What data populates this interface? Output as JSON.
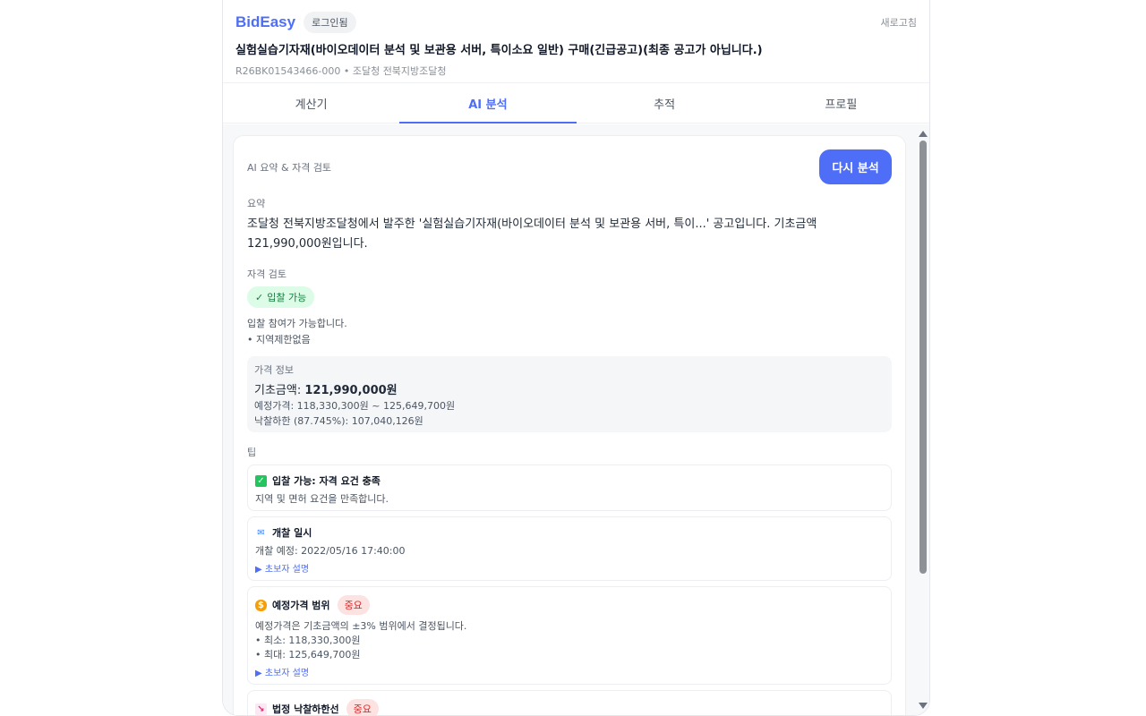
{
  "header": {
    "brand": "BidEasy",
    "login_badge": "로그인됨",
    "refresh": "새로고침",
    "title": "실험실습기자재(바이오데이터 분석 및 보관용 서버, 특이소요 일반) 구매(긴급공고)(최종 공고가 아닙니다.)",
    "meta": "R26BK01543466-000 • 조달청 전북지방조달청"
  },
  "tabs": [
    {
      "label": "계산기",
      "active": false
    },
    {
      "label": "AI 분석",
      "active": true
    },
    {
      "label": "추적",
      "active": false
    },
    {
      "label": "프로필",
      "active": false
    }
  ],
  "analysis": {
    "section_label": "AI 요약 & 자격 검토",
    "reanalyze_button": "다시 분석",
    "summary_label": "요약",
    "summary_text": "조달청 전북지방조달청에서 발주한 '실험실습기자재(바이오데이터 분석 및 보관용 서버, 특이...' 공고입니다. 기초금액 121,990,000원입니다.",
    "qualification_label": "자격 검토",
    "qualification_badge": "입찰 가능",
    "qualification_desc": "입찰 참여가 가능합니다.",
    "qualification_note": "• 지역제한없음"
  },
  "price": {
    "title": "가격 정보",
    "base_label": "기초금액:",
    "base_value": "121,990,000원",
    "estimate": "예정가격: 118,330,300원 ~ 125,649,700원",
    "lower_limit": "낙찰하한 (87.745%): 107,040,126원"
  },
  "tips": {
    "label": "팁",
    "items": [
      {
        "icon": "check-box-icon",
        "title": "입찰 가능: 자격 요건 충족",
        "important": "",
        "lines": [
          "지역 및 면허 요건을 만족합니다."
        ],
        "link": ""
      },
      {
        "icon": "mailbox-icon",
        "title": "개찰 일시",
        "important": "",
        "lines": [
          "개찰 예정: 2022/05/16 17:40:00"
        ],
        "link": "▶ 초보자 설명"
      },
      {
        "icon": "money-bag-icon",
        "title": "예정가격 범위",
        "important": "중요",
        "lines": [
          "예정가격은 기초금액의 ±3% 범위에서 결정됩니다.",
          "• 최소: 118,330,300원",
          "• 최대: 125,649,700원"
        ],
        "link": "▶ 초보자 설명"
      },
      {
        "icon": "chart-down-icon",
        "title": "법정 낙찰하한선",
        "important": "중요",
        "lines": [],
        "link": ""
      }
    ]
  },
  "colors": {
    "accent": "#4f6ef7",
    "success_bg": "#dcfce7",
    "success_text": "#15803d",
    "important_bg": "#fde2e2",
    "important_text": "#dc2626"
  }
}
